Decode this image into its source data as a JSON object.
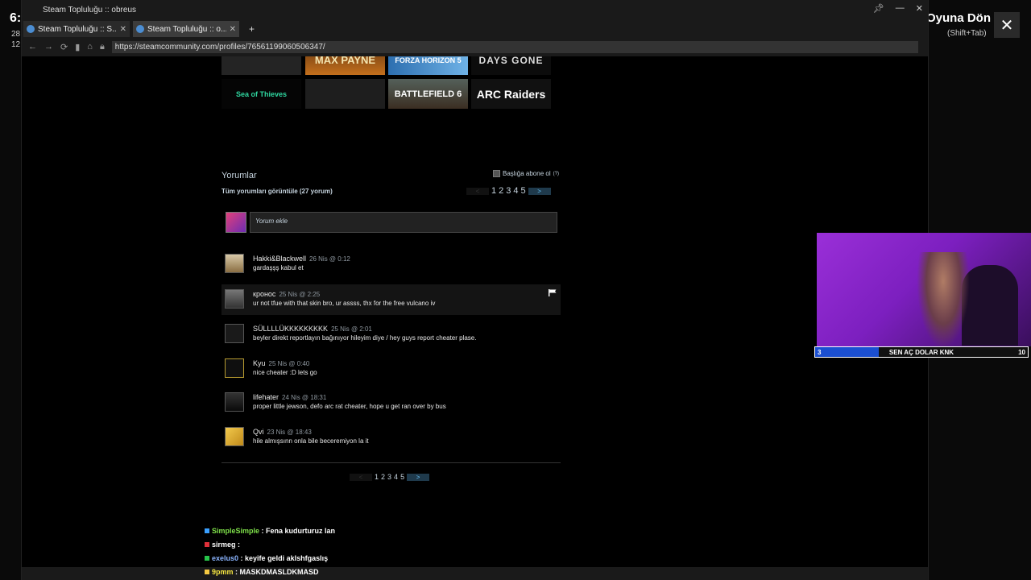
{
  "overlay": {
    "clock": "6:",
    "date_line1": "28",
    "date_line2": "12.",
    "return_label": "Oyuna Dön",
    "return_hint": "(Shift+Tab)",
    "close_symbol": "✕"
  },
  "browser": {
    "window_title": "Steam Topluluğu :: obreus",
    "tabs": [
      {
        "label": "Steam Topluluğu :: S..."
      },
      {
        "label": "Steam Topluluğu :: o..."
      }
    ],
    "new_tab": "+",
    "url": "https://steamcommunity.com/profiles/76561199060506347/"
  },
  "games": [
    {
      "label": ""
    },
    {
      "label": "MAX PAYNE"
    },
    {
      "label": "FORZA HORIZON 5"
    },
    {
      "label": "DAYS GONE"
    },
    {
      "label": "Sea of Thieves"
    },
    {
      "label": ""
    },
    {
      "label": "BATTLEFIELD 6"
    },
    {
      "label": "ARC Raiders"
    }
  ],
  "comments_section": {
    "title": "Yorumlar",
    "subscribe_label": "Başlığa abone ol",
    "subscribe_help": "(?)",
    "view_all": "Tüm yorumları görüntüle (27 yorum)",
    "composer_placeholder": "Yorum ekle",
    "pager": {
      "prev": "<",
      "next": ">",
      "pages": [
        "1",
        "2",
        "3",
        "4",
        "5"
      ]
    },
    "comments": [
      {
        "author": "Hakki&Blackwell",
        "time": "26 Nis @ 0:12",
        "text": "gardaşşş kabul et"
      },
      {
        "author": "кронос",
        "time": "25 Nis @ 2:25",
        "text": "ur not tfue with that skin bro, ur assss, thx for the free vulcano iv"
      },
      {
        "author": "SÜLLLLÜKKKKKKKKK",
        "time": "25 Nis @ 2:01",
        "text": "beyler direkt reportlayın bağınıyor hileyim diye / hey guys report cheater plase."
      },
      {
        "author": "Kyu",
        "time": "25 Nis @ 0:40",
        "text": "nice cheater :D lets go"
      },
      {
        "author": "lifehater",
        "time": "24 Nis @ 18:31",
        "text": "proper little jewson, defo arc rat cheater, hope u get ran over by bus"
      },
      {
        "author": "Qvi",
        "time": "23 Nis @ 18:43",
        "text": "hile almışsınn onla bile beceremiyon la it"
      }
    ]
  },
  "chat": [
    {
      "user": "SimpleSimple",
      "message": ": Fena kudurturuz lan",
      "color": "#7fe04a"
    },
    {
      "user": "sirmeg",
      "message": ":",
      "color": "#ffffff"
    },
    {
      "user": "exelus0",
      "message": ": keyife geldi aklshfgaslış",
      "color": "#8ab4ff"
    },
    {
      "user": "9pmm",
      "message": ": MASKDMASLDKMASD",
      "color": "#f5e642"
    }
  ],
  "goal": {
    "current": "3",
    "label": "SEN AÇ DOLAR KNK",
    "max": "10",
    "progress_fraction": 0.3
  },
  "colors": {
    "steam_link": "#67c1f5",
    "goal_fill": "#1b4fd1"
  }
}
